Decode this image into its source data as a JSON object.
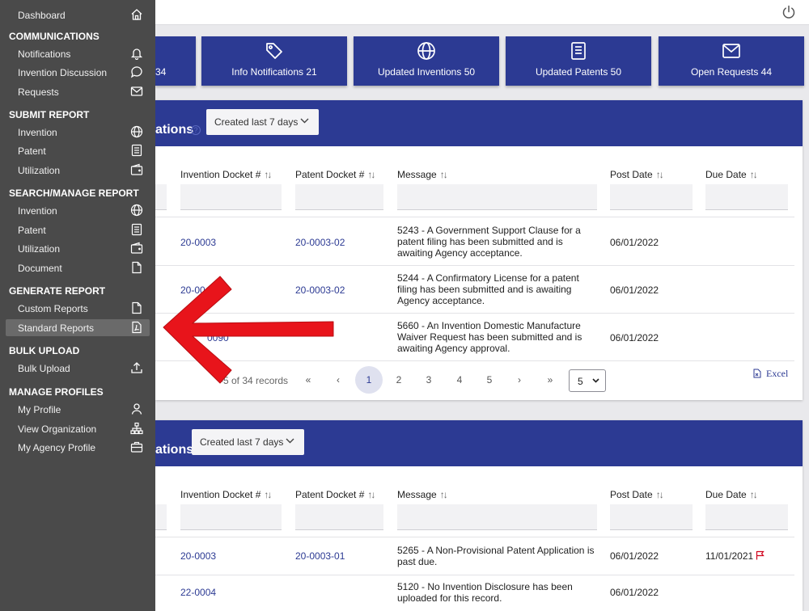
{
  "tiles": [
    {
      "label": "34",
      "icon": "bell-icon"
    },
    {
      "label": "Info Notifications 21",
      "icon": "tag-icon"
    },
    {
      "label": "Updated Inventions 50",
      "icon": "globe-icon"
    },
    {
      "label": "Updated Patents 50",
      "icon": "document-icon"
    },
    {
      "label": "Open Requests 44",
      "icon": "envelope-icon"
    }
  ],
  "card1": {
    "title": "ations",
    "period": "Created last 7 days",
    "headers": {
      "docket": "Invention Docket #",
      "patent": "Patent Docket #",
      "message": "Message",
      "post": "Post Date",
      "due": "Due Date"
    },
    "rows": [
      {
        "docket": "20-0003",
        "patent": "20-0003-02",
        "message": "5243 - A Government Support Clause for a patent filing has been submitted and is awaiting Agency acceptance.",
        "post": "06/01/2022",
        "due": ""
      },
      {
        "docket": "20-00",
        "patent": "20-0003-02",
        "message": "5244 - A Confirmatory License for a patent filing has been submitted and is awaiting Agency acceptance.",
        "post": "06/01/2022",
        "due": ""
      },
      {
        "docket": "0090",
        "patent": "",
        "message": "5660 - An Invention Domestic Manufacture Waiver Request has been submitted and is awaiting Agency approval.",
        "post": "06/01/2022",
        "due": ""
      }
    ],
    "records": "-5 of 34 records",
    "pages": [
      "1",
      "2",
      "3",
      "4",
      "5"
    ],
    "first": "«",
    "prev": "‹",
    "next": "›",
    "last": "»",
    "per_page": "5",
    "export_label": "Excel"
  },
  "card2": {
    "title": "ations",
    "period": "Created last 7 days",
    "headers": {
      "docket": "Invention Docket #",
      "patent": "Patent Docket #",
      "message": "Message",
      "post": "Post Date",
      "due": "Due Date"
    },
    "rows": [
      {
        "docket": "20-0003",
        "patent": "20-0003-01",
        "message": "5265 - A Non-Provisional Patent Application is past due.",
        "post": "06/01/2022",
        "due": "11/01/2021"
      },
      {
        "docket": "22-0004",
        "patent": "",
        "message": "5120 - No Invention Disclosure has been uploaded for this record.",
        "post": "06/01/2022",
        "due": ""
      }
    ]
  },
  "sidebar": {
    "dashboard": "Dashboard",
    "communications": "COMMUNICATIONS",
    "notifications": "Notifications",
    "invention_discussion": "Invention Discussion",
    "requests": "Requests",
    "submit_report": "SUBMIT REPORT",
    "submit_invention": "Invention",
    "submit_patent": "Patent",
    "submit_utilization": "Utilization",
    "search_manage": "SEARCH/MANAGE REPORT",
    "search_invention": "Invention",
    "search_patent": "Patent",
    "search_utilization": "Utilization",
    "search_document": "Document",
    "generate_report": "GENERATE REPORT",
    "custom_reports": "Custom Reports",
    "standard_reports": "Standard Reports",
    "bulk_upload_head": "BULK UPLOAD",
    "bulk_upload": "Bulk Upload",
    "manage_profiles": "MANAGE PROFILES",
    "my_profile": "My Profile",
    "view_organization": "View Organization",
    "my_agency_profile": "My Agency Profile"
  },
  "colors": {
    "brand": "#2c3a93",
    "sidebar": "#4a4a4a",
    "arrow": "#e8141b",
    "flag": "#d0021b"
  }
}
